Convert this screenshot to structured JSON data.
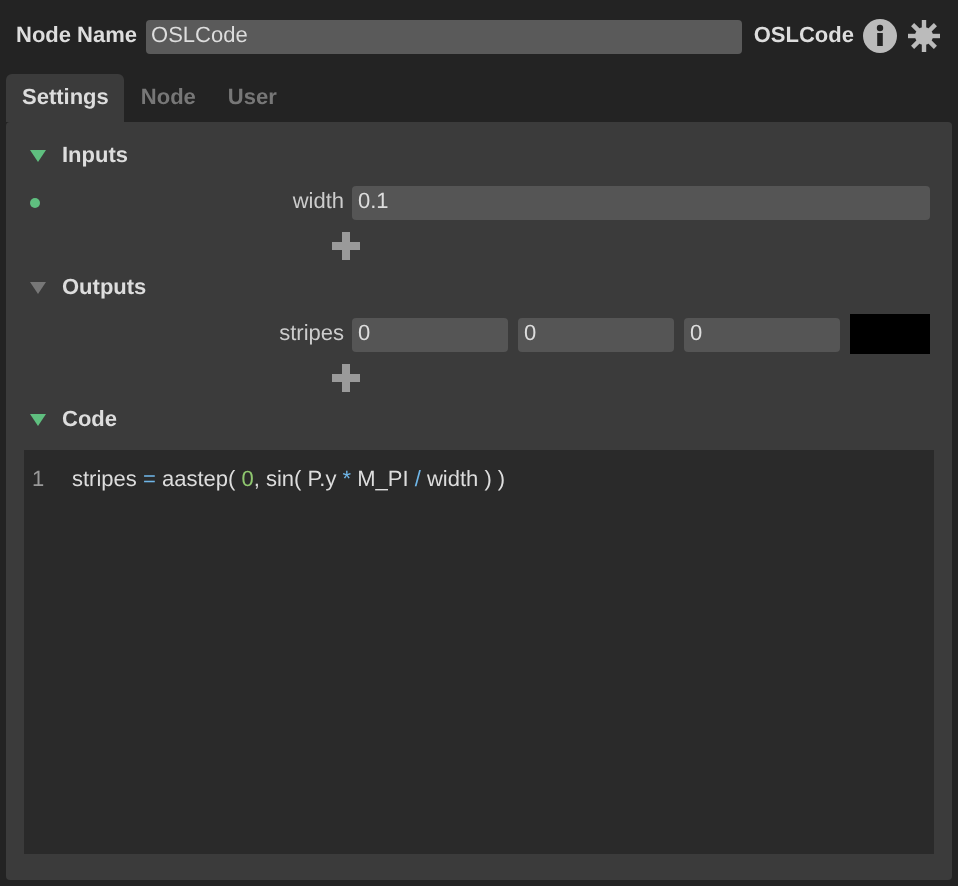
{
  "header": {
    "label": "Node Name",
    "value": "OSLCode",
    "type_label": "OSLCode"
  },
  "tabs": [
    {
      "label": "Settings",
      "selected": true
    },
    {
      "label": "Node",
      "selected": false
    },
    {
      "label": "User",
      "selected": false
    }
  ],
  "inputs": {
    "title": "Inputs",
    "expanded": true,
    "color": "#5fbf7f",
    "params": [
      {
        "name": "width",
        "connected": true,
        "values": [
          "0.1"
        ]
      }
    ]
  },
  "outputs": {
    "title": "Outputs",
    "expanded": true,
    "color": "#777777",
    "params": [
      {
        "name": "stripes",
        "connected": false,
        "values": [
          "0",
          "0",
          "0"
        ],
        "color": "#000000"
      }
    ]
  },
  "code": {
    "title": "Code",
    "expanded": true,
    "color": "#5fbf7f",
    "lines": [
      {
        "number": "1",
        "tokens": [
          {
            "kind": "text",
            "text": "stripes "
          },
          {
            "kind": "operator",
            "text": "="
          },
          {
            "kind": "text",
            "text": " aastep( "
          },
          {
            "kind": "number",
            "text": "0"
          },
          {
            "kind": "text",
            "text": ", sin( P.y "
          },
          {
            "kind": "operator",
            "text": "*"
          },
          {
            "kind": "text",
            "text": " M_PI "
          },
          {
            "kind": "operator",
            "text": "/"
          },
          {
            "kind": "text",
            "text": " width ) )"
          }
        ]
      }
    ]
  }
}
